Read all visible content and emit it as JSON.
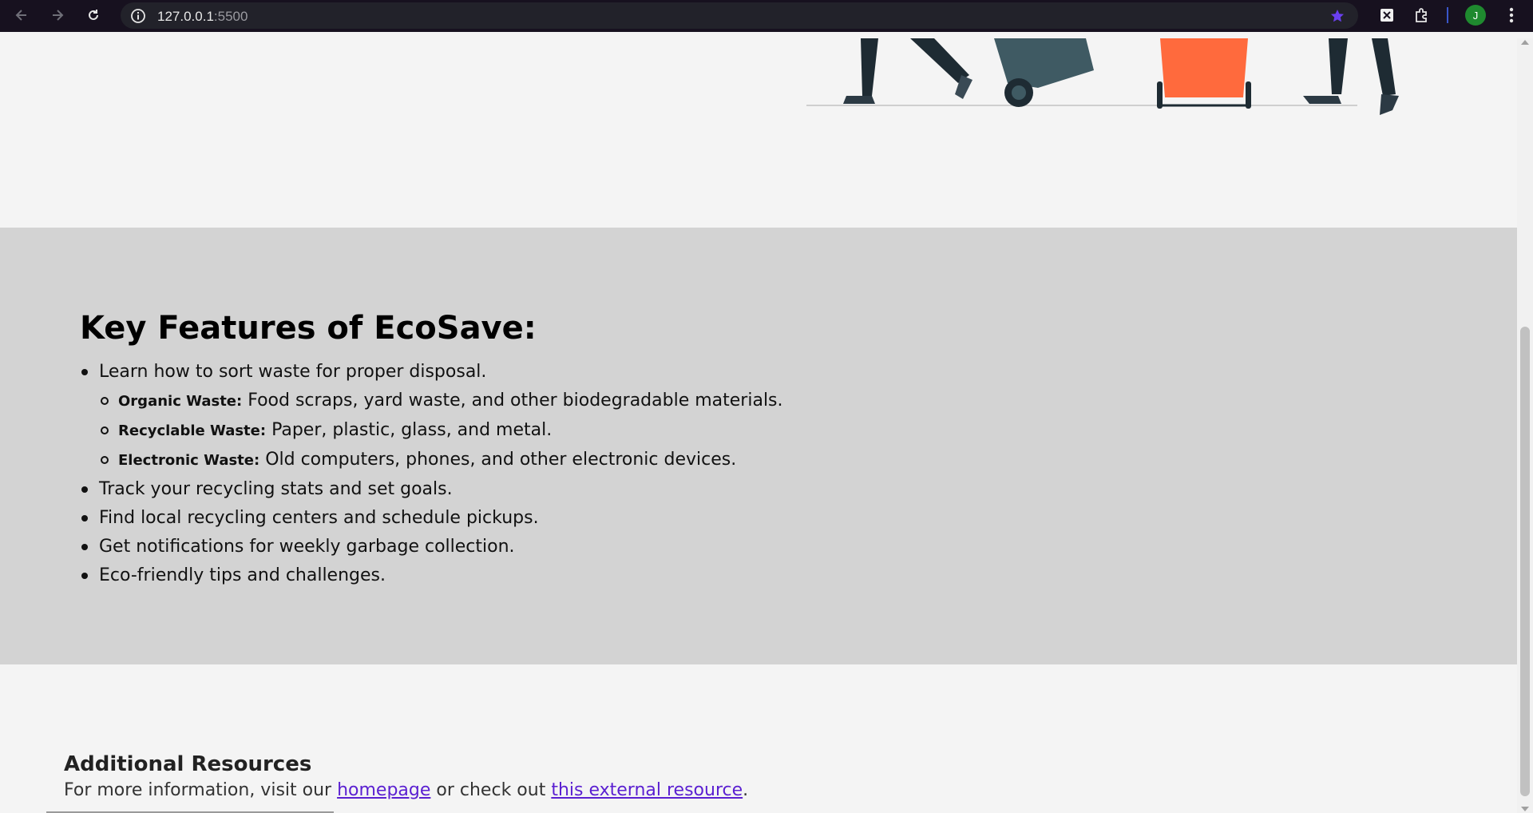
{
  "browser": {
    "url_host": "127.0.0.1",
    "url_port": ":5500",
    "profile_initial": "J",
    "icons": [
      "back-arrow-icon",
      "forward-arrow-icon",
      "reload-icon",
      "site-info-icon",
      "bookmark-star-icon",
      "extension-x-icon",
      "extensions-puzzle-icon",
      "menu-kebab-icon"
    ]
  },
  "features": {
    "title": "Key Features of EcoSave:",
    "items": [
      "Learn how to sort waste for proper disposal.",
      "Track your recycling stats and set goals.",
      "Find local recycling centers and schedule pickups.",
      "Get notifications for weekly garbage collection.",
      "Eco-friendly tips and challenges."
    ],
    "sub_items": [
      {
        "label": "Organic Waste:",
        "text": "Food scraps, yard waste, and other biodegradable materials."
      },
      {
        "label": "Recyclable Waste:",
        "text": "Paper, plastic, glass, and metal."
      },
      {
        "label": "Electronic Waste:",
        "text": "Old computers, phones, and other electronic devices."
      }
    ]
  },
  "resources": {
    "title": "Additional Resources",
    "text_before": "For more information, visit our ",
    "link_home": "homepage",
    "text_middle": " or check out ",
    "link_external": "this external resource",
    "text_after": "."
  },
  "colors": {
    "accent_bookmark": "#6a3ff0",
    "link": "#5a1fd1",
    "features_bg": "#d3d3d3",
    "bin_orange": "#ff6a3d",
    "bin_teal": "#3f5a63"
  }
}
